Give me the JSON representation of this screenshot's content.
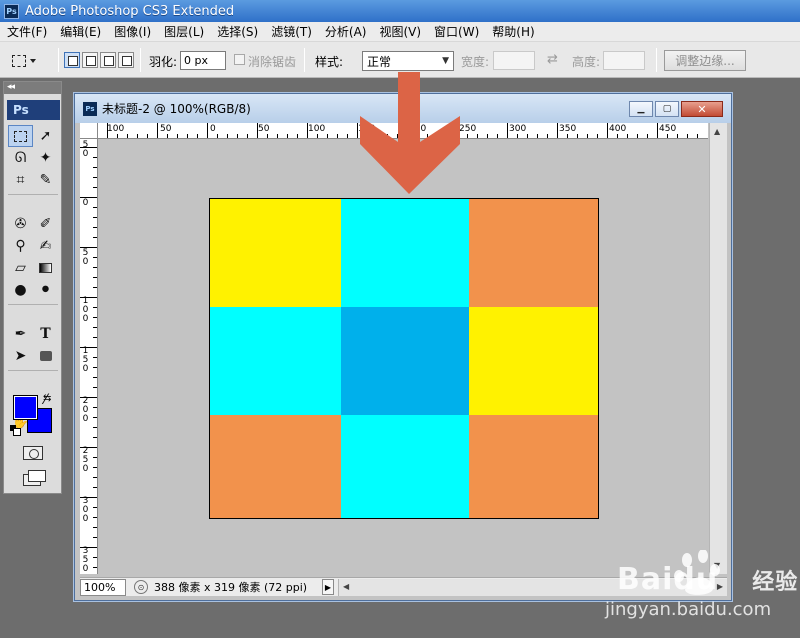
{
  "window": {
    "title": "Adobe Photoshop CS3 Extended",
    "icon_text": "Ps"
  },
  "menu": [
    "文件(F)",
    "编辑(E)",
    "图像(I)",
    "图层(L)",
    "选择(S)",
    "滤镜(T)",
    "分析(A)",
    "视图(V)",
    "窗口(W)",
    "帮助(H)"
  ],
  "options_bar": {
    "feather_label": "羽化:",
    "feather_value": "0 px",
    "antialias_label": "消除锯齿",
    "style_label": "样式:",
    "style_value": "正常",
    "width_label": "宽度:",
    "height_label": "高度:",
    "refine_edge_label": "调整边缘..."
  },
  "tools_panel": {
    "collapse_glyph": "◂◂",
    "logo": "Ps",
    "foreground_color": "#0000ff",
    "background_color": "#0000ff"
  },
  "document": {
    "title": "未标题-2 @ 100%(RGB/8)",
    "icon_text": "Ps",
    "ruler_top_labels": [
      "100",
      "50",
      "0",
      "50",
      "100",
      "150",
      "200",
      "250",
      "300",
      "350",
      "400",
      "450"
    ],
    "ruler_left_labels": [
      "5 0",
      "0",
      "5 0",
      "1 0 0",
      "1 5 0",
      "2 0 0",
      "2 5 0",
      "3 0 0",
      "3 5 0"
    ],
    "zoom": "100%",
    "status_text": "388 像素 x 319 像素 (72 ppi)",
    "image_colors": [
      [
        "#fff200",
        "#00ffff",
        "#f2924c"
      ],
      [
        "#00ffff",
        "#00b0eb",
        "#fff200"
      ],
      [
        "#f2924c",
        "#00ffff",
        "#f2924c"
      ]
    ]
  },
  "annotation": {
    "arrow_color": "#dc6446"
  },
  "watermark": {
    "brand": "Baidu",
    "suffix": "经验",
    "url": "jingyan.baidu.com"
  }
}
